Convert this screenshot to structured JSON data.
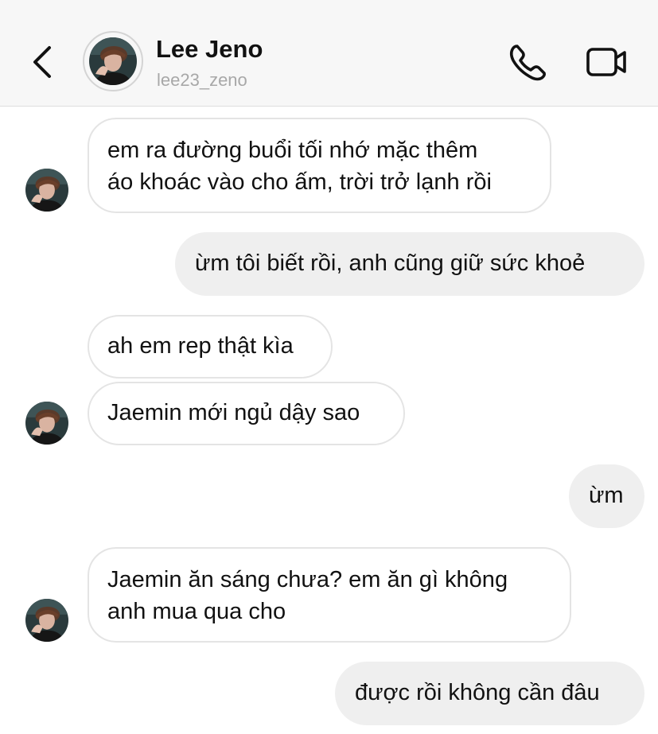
{
  "header": {
    "name": "Lee Jeno",
    "username": "lee23_zeno"
  },
  "icons": {
    "back": "chevron-left-icon",
    "call": "phone-icon",
    "video": "video-camera-icon"
  },
  "messages": [
    {
      "direction": "incoming",
      "text_lines": [
        "em ra đường buổi tối nhớ mặc thêm",
        "áo khoác vào cho ấm, trời trở lạnh rồi"
      ]
    },
    {
      "direction": "outgoing",
      "text": "ừm tôi biết rồi, anh cũng giữ sức khoẻ"
    },
    {
      "direction": "incoming",
      "text": "ah em rep thật kìa"
    },
    {
      "direction": "incoming",
      "text": "Jaemin mới ngủ dậy sao"
    },
    {
      "direction": "outgoing",
      "text": "ừm"
    },
    {
      "direction": "incoming",
      "text_lines": [
        "Jaemin ăn sáng chưa? em ăn gì không",
        "anh mua qua cho"
      ]
    },
    {
      "direction": "outgoing",
      "text": "được rồi không cần đâu"
    }
  ],
  "colors": {
    "header_bg": "#f7f7f7",
    "incoming_bubble_bg": "#ffffff",
    "incoming_bubble_border": "#e4e4e4",
    "outgoing_bubble_bg": "#efefef",
    "username_gray": "#a8a8a8"
  }
}
